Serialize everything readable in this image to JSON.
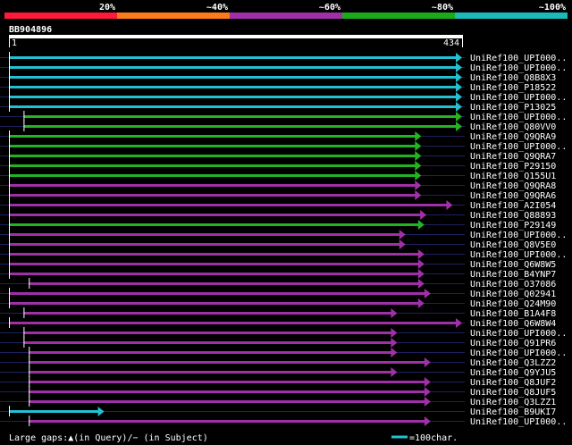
{
  "identity_scale": {
    "labels": [
      "20%",
      "~40%",
      "~60%",
      "~80%",
      "~100%"
    ],
    "colors": [
      "#ff1a3a",
      "#ff7a1a",
      "#a030a8",
      "#1aaa1a",
      "#1ababa"
    ]
  },
  "query": {
    "name": "BB904896",
    "start": "1",
    "end": "434",
    "length": 434
  },
  "colors": {
    "cyan": "#22c0d0",
    "green": "#22b422",
    "purple": "#a030a8",
    "gap": "#202060",
    "background": "#000000"
  },
  "hits": [
    {
      "label": "UniRef100_UPI000..",
      "color": "cyan",
      "start": 1,
      "end": 434
    },
    {
      "label": "UniRef100_UPI000..",
      "color": "cyan",
      "start": 1,
      "end": 434
    },
    {
      "label": "UniRef100_Q8B8X3",
      "color": "cyan",
      "start": 1,
      "end": 434
    },
    {
      "label": "UniRef100_P18522",
      "color": "cyan",
      "start": 1,
      "end": 434
    },
    {
      "label": "UniRef100_UPI000..",
      "color": "cyan",
      "start": 1,
      "end": 434
    },
    {
      "label": "UniRef100_P13025",
      "color": "cyan",
      "start": 1,
      "end": 434
    },
    {
      "label": "UniRef100_UPI000..",
      "color": "green",
      "start": 15,
      "end": 434
    },
    {
      "label": "UniRef100_Q80VV0",
      "color": "green",
      "start": 15,
      "end": 434
    },
    {
      "label": "UniRef100_Q9QRA9",
      "color": "green",
      "start": 1,
      "end": 395
    },
    {
      "label": "UniRef100_UPI000..",
      "color": "green",
      "start": 1,
      "end": 395
    },
    {
      "label": "UniRef100_Q9QRA7",
      "color": "green",
      "start": 1,
      "end": 395
    },
    {
      "label": "UniRef100_P29150",
      "color": "green",
      "start": 1,
      "end": 395
    },
    {
      "label": "UniRef100_Q155U1",
      "color": "green",
      "start": 1,
      "end": 395
    },
    {
      "label": "UniRef100_Q9QRA8",
      "color": "purple",
      "start": 1,
      "end": 395
    },
    {
      "label": "UniRef100_Q9QRA6",
      "color": "purple",
      "start": 1,
      "end": 395
    },
    {
      "label": "UniRef100_A2I054",
      "color": "purple",
      "start": 1,
      "end": 425
    },
    {
      "label": "UniRef100_Q88893",
      "color": "purple",
      "start": 1,
      "end": 400
    },
    {
      "label": "UniRef100_P29149",
      "color": "green",
      "start": 1,
      "end": 398
    },
    {
      "label": "UniRef100_UPI000..",
      "color": "purple",
      "start": 1,
      "end": 380
    },
    {
      "label": "UniRef100_Q8V5E0",
      "color": "purple",
      "start": 1,
      "end": 380
    },
    {
      "label": "UniRef100_UPI000..",
      "color": "purple",
      "start": 1,
      "end": 398
    },
    {
      "label": "UniRef100_Q6W8W5",
      "color": "purple",
      "start": 1,
      "end": 398
    },
    {
      "label": "UniRef100_B4YNP7",
      "color": "purple",
      "start": 1,
      "end": 398
    },
    {
      "label": "UniRef100_O37086",
      "color": "purple",
      "start": 20,
      "end": 398
    },
    {
      "label": "UniRef100_Q02941",
      "color": "purple",
      "start": 1,
      "end": 404
    },
    {
      "label": "UniRef100_Q24M90",
      "color": "purple",
      "start": 1,
      "end": 398
    },
    {
      "label": "UniRef100_B1A4F8",
      "color": "purple",
      "start": 15,
      "end": 372
    },
    {
      "label": "UniRef100_Q6W8W4",
      "color": "purple",
      "start": 1,
      "end": 434
    },
    {
      "label": "UniRef100_UPI000..",
      "color": "purple",
      "start": 15,
      "end": 372
    },
    {
      "label": "UniRef100_Q91PR6",
      "color": "purple",
      "start": 15,
      "end": 372
    },
    {
      "label": "UniRef100_UPI000..",
      "color": "purple",
      "start": 20,
      "end": 372
    },
    {
      "label": "UniRef100_Q3LZZ2",
      "color": "purple",
      "start": 20,
      "end": 404
    },
    {
      "label": "UniRef100_Q9YJU5",
      "color": "purple",
      "start": 20,
      "end": 372
    },
    {
      "label": "UniRef100_Q8JUF2",
      "color": "purple",
      "start": 20,
      "end": 404
    },
    {
      "label": "UniRef100_Q8JUF5",
      "color": "purple",
      "start": 20,
      "end": 404
    },
    {
      "label": "UniRef100_Q3LZZ1",
      "color": "purple",
      "start": 20,
      "end": 404
    },
    {
      "label": "UniRef100_B9UKI7",
      "color": "cyan",
      "start": 1,
      "end": 92
    },
    {
      "label": "UniRef100_UPI000..",
      "color": "purple",
      "start": 20,
      "end": 404
    }
  ],
  "footer": {
    "gaps_legend": "Large gaps:▲(in Query)/− (in Subject)",
    "scale_legend": "=100char."
  }
}
